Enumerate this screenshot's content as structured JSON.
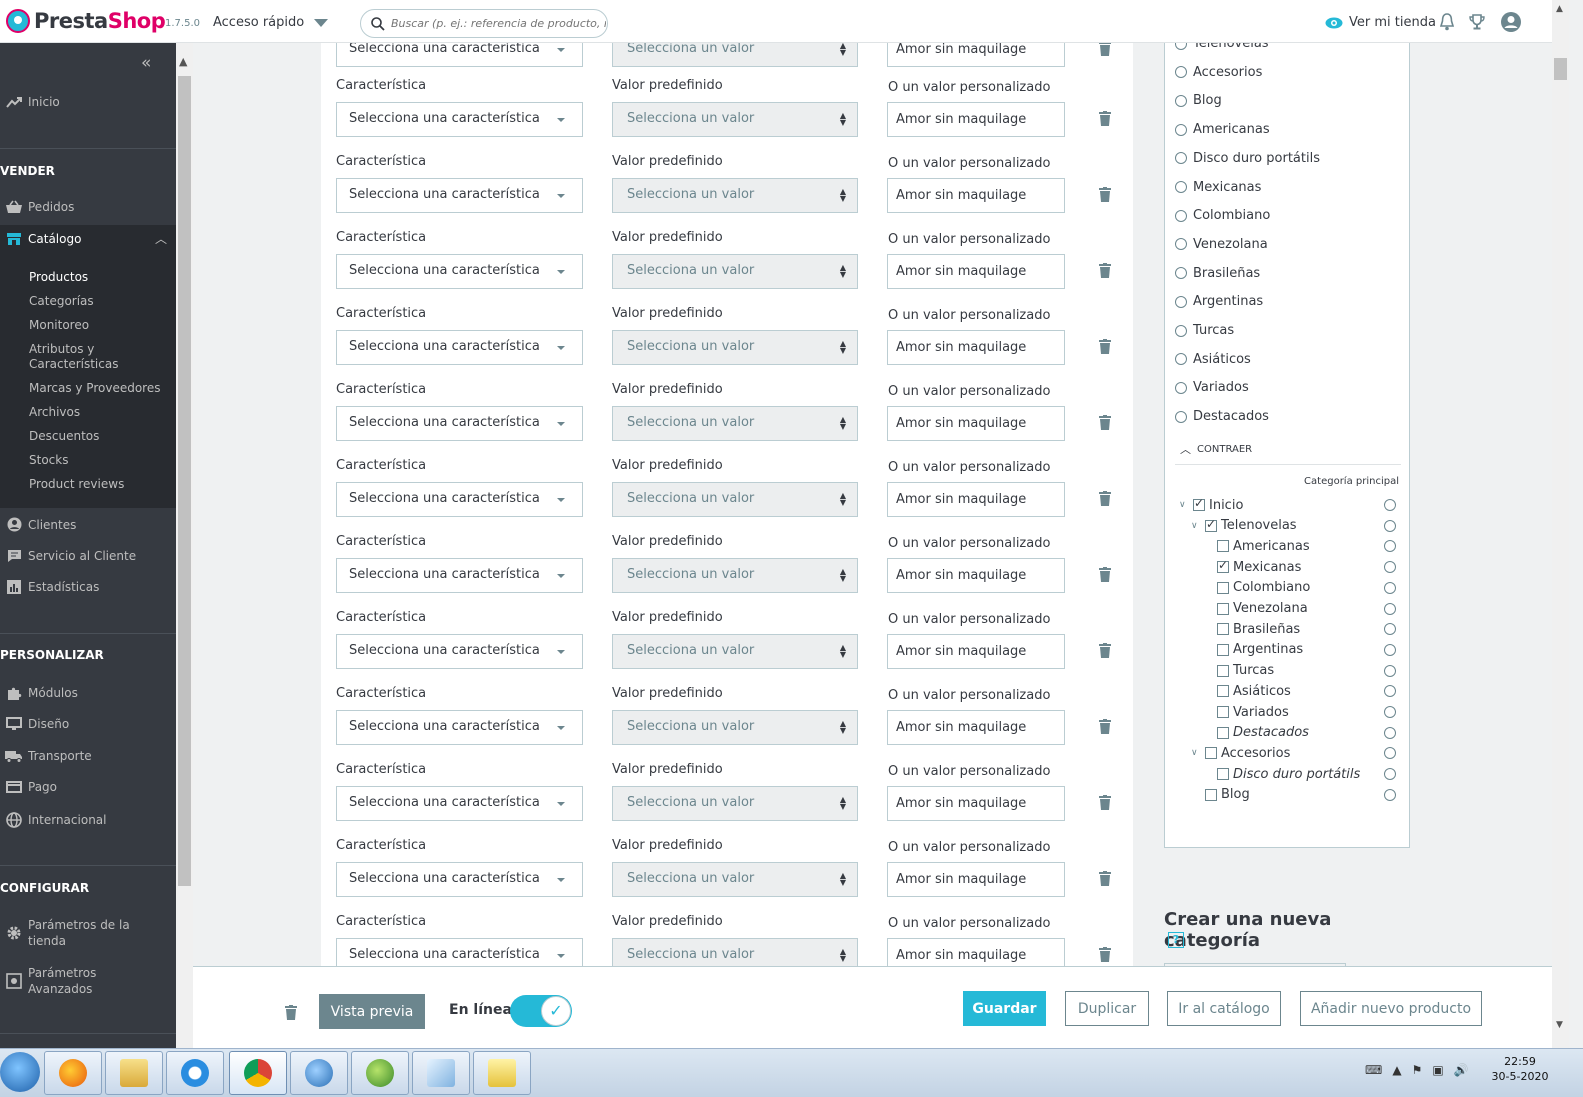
{
  "topbar": {
    "logo_part1": "Presta",
    "logo_part2": "Shop",
    "version": "1.7.5.0",
    "quick_access": "Acceso rápido",
    "search_placeholder": "Buscar (p. ej.: referencia de producto, nombre de cliente...)",
    "view_store": "Ver mi tienda"
  },
  "sidebar": {
    "home": "Inicio",
    "section_sell": "VENDER",
    "orders": "Pedidos",
    "catalog": "Catálogo",
    "catalog_sub": [
      "Productos",
      "Categorías",
      "Monitoreo",
      "Atributos y Características",
      "Marcas y Proveedores",
      "Archivos",
      "Descuentos",
      "Stocks",
      "Product reviews"
    ],
    "customers": "Clientes",
    "customer_service": "Servicio al Cliente",
    "stats": "Estadísticas",
    "section_customize": "PERSONALIZAR",
    "modules": "Módulos",
    "design": "Diseño",
    "shipping": "Transporte",
    "payment": "Pago",
    "international": "Internacional",
    "section_configure": "CONFIGURAR",
    "shop_params": "Parámetros de la tienda",
    "advanced_params": "Parámetros Avanzados"
  },
  "features": {
    "label_feature": "Característica",
    "label_value": "Valor predefinido",
    "label_custom": "O un valor personalizado",
    "select_feature": "Selecciona una característica",
    "select_value": "Selecciona un valor",
    "custom_value": "Amor sin maquilage",
    "top_partial_feature": "Selecciona una característica",
    "top_partial_value": "Selecciona un valor",
    "top_partial_custom": "Amor sin maquilage"
  },
  "categories": {
    "radio_list": [
      "Telenovelas",
      "Accesorios",
      "Blog",
      "Americanas",
      "Disco duro portátils",
      "Mexicanas",
      "Colombiano",
      "Venezolana",
      "Brasileñas",
      "Argentinas",
      "Turcas",
      "Asiáticos",
      "Variados",
      "Destacados"
    ],
    "collapse": "CONTRAER",
    "main_category": "Categoría principal",
    "tree": [
      {
        "label": "Inicio",
        "checked": true
      },
      {
        "label": "Telenovelas",
        "checked": true
      },
      {
        "label": "Americanas",
        "checked": false
      },
      {
        "label": "Mexicanas",
        "checked": true
      },
      {
        "label": "Colombiano",
        "checked": false
      },
      {
        "label": "Venezolana",
        "checked": false
      },
      {
        "label": "Brasileñas",
        "checked": false
      },
      {
        "label": "Argentinas",
        "checked": false
      },
      {
        "label": "Turcas",
        "checked": false
      },
      {
        "label": "Asiáticos",
        "checked": false
      },
      {
        "label": "Variados",
        "checked": false
      },
      {
        "label": "Destacados",
        "checked": false
      },
      {
        "label": "Accesorios",
        "checked": false
      },
      {
        "label": "Disco duro portátils",
        "checked": false
      },
      {
        "label": "Blog",
        "checked": false
      }
    ],
    "new_category_title": "Crear una nueva categoría",
    "help": "?"
  },
  "bottombar": {
    "preview": "Vista previa",
    "online": "En línea",
    "save": "Guardar",
    "duplicate": "Duplicar",
    "go_catalog": "Ir al catálogo",
    "add_product": "Añadir nuevo producto"
  },
  "taskbar": {
    "time": "22:59",
    "date": "30-5-2020"
  },
  "colors": {
    "accent": "#25b9d7",
    "sidebar": "#363a41",
    "brand_pink": "#df0067"
  }
}
